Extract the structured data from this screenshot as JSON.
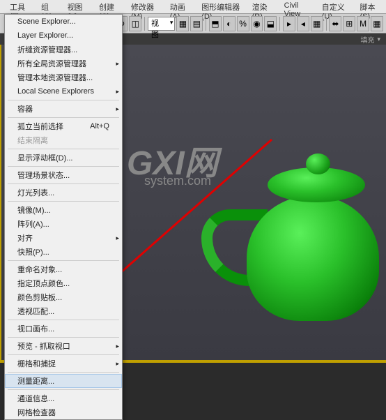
{
  "menubar": {
    "items": [
      {
        "label": "工具(T)"
      },
      {
        "label": "组(G)"
      },
      {
        "label": "视图(V)"
      },
      {
        "label": "创建(C)"
      },
      {
        "label": "修改器(M)"
      },
      {
        "label": "动画(A)"
      },
      {
        "label": "图形编辑器(D)"
      },
      {
        "label": "渲染(R)"
      },
      {
        "label": "Civil View"
      },
      {
        "label": "自定义(U)"
      },
      {
        "label": "脚本(S)"
      }
    ]
  },
  "toolbar": {
    "combo_label": "视图"
  },
  "secondary_bar": {
    "label": "填充"
  },
  "dropdown": {
    "items": [
      {
        "label": "Scene Explorer...",
        "submenu": false
      },
      {
        "label": "Layer Explorer...",
        "submenu": false
      },
      {
        "label": "折缝资源管理器...",
        "submenu": false
      },
      {
        "label": "所有全局资源管理器",
        "submenu": true
      },
      {
        "label": "管理本地资源管理器...",
        "submenu": false
      },
      {
        "label": "Local Scene Explorers",
        "submenu": true
      },
      {
        "sep": true
      },
      {
        "label": "容器",
        "submenu": true
      },
      {
        "sep": true
      },
      {
        "label": "孤立当前选择",
        "shortcut": "Alt+Q"
      },
      {
        "label": "结束隔离",
        "disabled": true
      },
      {
        "sep": true
      },
      {
        "label": "显示浮动框(D)...",
        "submenu": false
      },
      {
        "sep": true
      },
      {
        "label": "管理场景状态...",
        "submenu": false
      },
      {
        "sep": true
      },
      {
        "label": "灯光列表...",
        "submenu": false
      },
      {
        "sep": true
      },
      {
        "label": "镜像(M)...",
        "submenu": false
      },
      {
        "label": "阵列(A)...",
        "submenu": false
      },
      {
        "label": "对齐",
        "submenu": true
      },
      {
        "label": "快照(P)...",
        "submenu": false
      },
      {
        "sep": true
      },
      {
        "label": "重命名对象...",
        "submenu": false
      },
      {
        "label": "指定顶点颜色...",
        "submenu": false
      },
      {
        "label": "颜色剪贴板...",
        "submenu": false
      },
      {
        "label": "透视匹配...",
        "submenu": false
      },
      {
        "sep": true
      },
      {
        "label": "视口画布...",
        "submenu": false
      },
      {
        "sep": true
      },
      {
        "label": "预览 - 抓取视口",
        "submenu": true
      },
      {
        "sep": true
      },
      {
        "label": "栅格和捕捉",
        "submenu": true
      },
      {
        "sep": true
      },
      {
        "label": "测量距离...",
        "hover": true
      },
      {
        "sep": true
      },
      {
        "label": "通道信息...",
        "submenu": false
      },
      {
        "label": "网格检查器",
        "submenu": false
      }
    ]
  },
  "watermark": {
    "main": "GXI网",
    "sub": "system.com"
  }
}
